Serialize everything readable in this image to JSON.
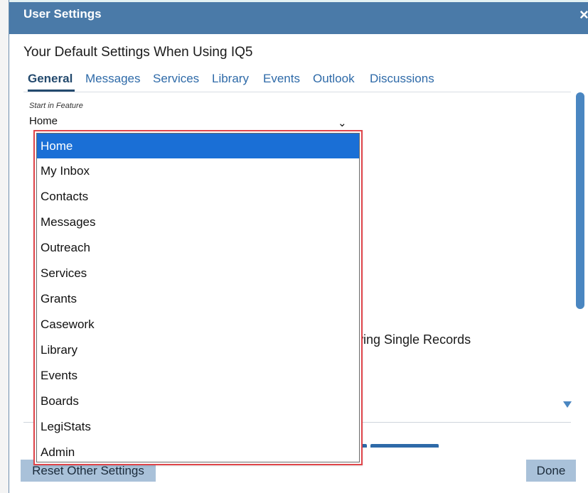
{
  "dialog": {
    "title": "User Settings",
    "close_symbol": "×",
    "heading": "Your Default Settings When Using IQ5"
  },
  "tabs": [
    {
      "label": "General",
      "active": true
    },
    {
      "label": "Messages",
      "active": false
    },
    {
      "label": "Services",
      "active": false
    },
    {
      "label": "Library",
      "active": false
    },
    {
      "label": "Events",
      "active": false
    },
    {
      "label": "Outlook",
      "active": false
    },
    {
      "label": "Discussions",
      "active": false
    }
  ],
  "start_feature": {
    "label": "Start in Feature",
    "value": "Home",
    "chevron_icon": "chevron-down-icon",
    "options": [
      "Home",
      "My Inbox",
      "Contacts",
      "Messages",
      "Outreach",
      "Services",
      "Grants",
      "Casework",
      "Library",
      "Events",
      "Boards",
      "LegiStats",
      "Admin"
    ]
  },
  "background": {
    "partial_text": "wing Single Records"
  },
  "footer": {
    "reset_label": "Reset Other Settings",
    "done_label": "Done"
  },
  "colors": {
    "titlebar": "#4a7aa8",
    "accent": "#2e6aa8",
    "selection": "#1a6fd6",
    "highlight_border": "#e0454a",
    "button_bg": "#a9c1d9"
  }
}
